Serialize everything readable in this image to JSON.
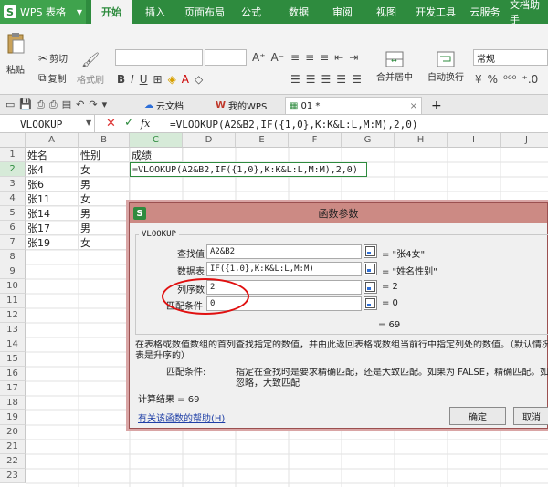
{
  "app": {
    "logo_letter": "S",
    "title": "WPS 表格",
    "accent_color": "#2e8b3e",
    "tabs": [
      "开始",
      "插入",
      "页面布局",
      "公式",
      "数据",
      "审阅",
      "视图",
      "开发工具",
      "云服务",
      "文档助手"
    ],
    "active_tab": 0
  },
  "ribbon": {
    "paste": "粘贴",
    "cut": "剪切",
    "copy": "复制",
    "format_painter": "格式刷",
    "merge_center": "合并居中",
    "wrap_text": "自动换行",
    "number_format": "常规",
    "font_bold": "B",
    "font_italic": "I",
    "font_underline": "U"
  },
  "doc_tabs": [
    {
      "label": "云文档"
    },
    {
      "label": "我的WPS"
    },
    {
      "label": "01 *"
    }
  ],
  "formula_bar": {
    "name_box": "VLOOKUP",
    "fx": "fx",
    "formula": "=VLOOKUP(A2&B2,IF({1,0},K:K&L:L,M:M),2,0)"
  },
  "grid": {
    "columns": [
      "A",
      "B",
      "C",
      "D",
      "E",
      "F",
      "G",
      "H",
      "I",
      "J"
    ],
    "rows": [
      "1",
      "2",
      "3",
      "4",
      "5",
      "6",
      "7",
      "8",
      "9",
      "10",
      "11",
      "12",
      "13",
      "14",
      "15",
      "16",
      "17",
      "18",
      "19",
      "20",
      "21",
      "22",
      "23"
    ],
    "cells": {
      "A1": "姓名",
      "B1": "性别",
      "C1": "成绩",
      "A2": "张4",
      "B2": "女",
      "C2": "=VLOOKUP(A2&B2,IF({1,0},K:K&L:L,M:M),2,0)",
      "A3": "张6",
      "B3": "男",
      "A4": "张11",
      "B4": "女",
      "A5": "张14",
      "B5": "男",
      "A6": "张17",
      "B6": "男",
      "A7": "张19",
      "B7": "女"
    }
  },
  "dialog": {
    "logo_letter": "S",
    "title": "函数参数",
    "function_name": "VLOOKUP",
    "args": [
      {
        "label": "查找值",
        "value": "A2&B2",
        "result": "= \"张4女\""
      },
      {
        "label": "数据表",
        "value": "IF({1,0},K:K&L:L,M:M)",
        "result": "= \"姓名性别\""
      },
      {
        "label": "列序数",
        "value": "2",
        "result": "= 2"
      },
      {
        "label": "匹配条件",
        "value": "0",
        "result": "= 0"
      }
    ],
    "overall_result": "= 69",
    "description": "在表格或数值数组的首列查找指定的数值，并由此返回表格或数组当前行中指定列处的数值。（默认情况下，",
    "description_line2": "表是升序的）",
    "param_name": "匹配条件:",
    "param_desc_line1": "指定在查找时是要求精确匹配，还是大致匹配。如果为 FALSE，精确匹配。如果为 TRUE",
    "param_desc_line2": "忽略，大致匹配",
    "calc_result": "计算结果 = 69",
    "help_link": "有关该函数的帮助(H)",
    "ok": "确定",
    "cancel": "取消"
  }
}
